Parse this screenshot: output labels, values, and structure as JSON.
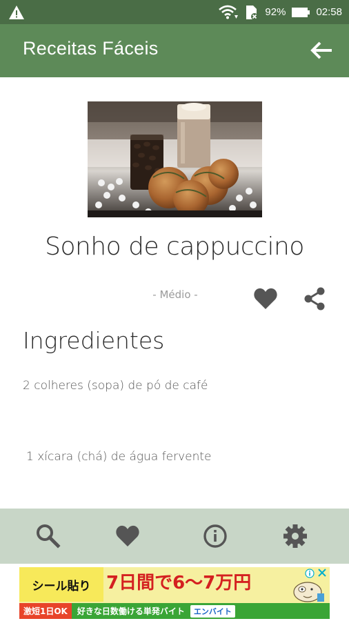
{
  "status_bar": {
    "battery": "92%",
    "time": "02:58"
  },
  "app_bar": {
    "title": "Receitas Fáceis"
  },
  "recipe": {
    "title": "Sonho de cappuccino",
    "difficulty": "- Médio -"
  },
  "ingredients": {
    "heading": "Ingredientes",
    "items": [
      "2 colheres (sopa) de pó de café",
      "1 xícara (chá) de água fervente"
    ]
  },
  "ad": {
    "left_text": "シール貼り",
    "main_text": "7日間で6～7万円",
    "promo_text": "激短1日OK",
    "sub_text": "好きな日数働ける単発バイト",
    "brand_text": "エンバイト"
  },
  "colors": {
    "status_bar": "#4a6d46",
    "app_bar": "#5d8a58",
    "bottom_nav": "#c8d6c7",
    "icon_dark": "#555555"
  },
  "icons": {
    "status_warning": "warning-icon",
    "wifi": "wifi-icon",
    "sim": "sim-card-icon",
    "battery": "battery-icon",
    "back": "arrow-left-icon",
    "favorite": "heart-icon",
    "share": "share-icon",
    "search": "search-icon",
    "info": "info-icon",
    "settings": "gear-icon"
  }
}
